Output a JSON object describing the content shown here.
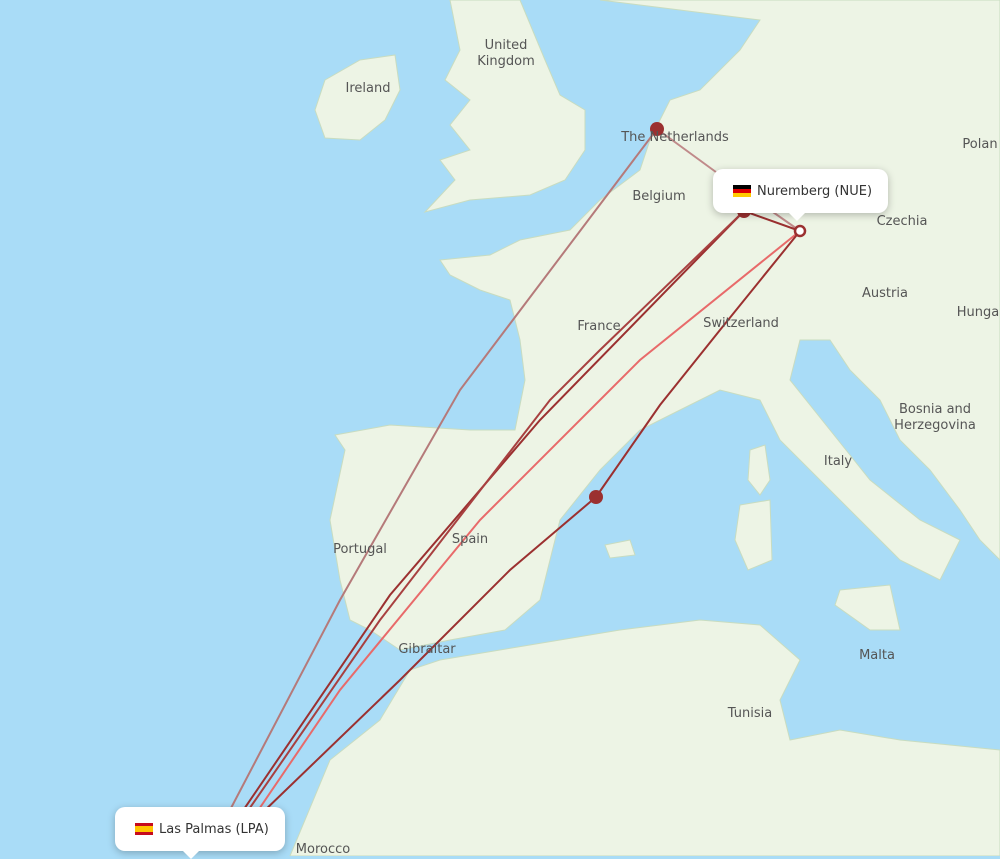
{
  "map": {
    "countries": [
      "Ireland",
      "United Kingdom",
      "The Netherlands",
      "Belgium",
      "France",
      "Switzerland",
      "Czechia",
      "Polan",
      "Austria",
      "Hunga",
      "Bosnia and Herzegovina",
      "Italy",
      "Portugal",
      "Spain",
      "Gibraltar",
      "Malta",
      "Tunisia",
      "Morocco"
    ],
    "colors": {
      "water": "#a9dcf7",
      "land": "#edf4e5",
      "route_dark": "#9b3030",
      "route_light": "#e86a6a",
      "route_brown": "#b57a7a"
    }
  },
  "origin": {
    "name": "Las Palmas (LPA)",
    "flag": "spain-flag"
  },
  "destination": {
    "name": "Nuremberg (NUE)",
    "flag": "germany-flag"
  },
  "stops": [
    "Amsterdam",
    "Frankfurt",
    "Barcelona"
  ]
}
